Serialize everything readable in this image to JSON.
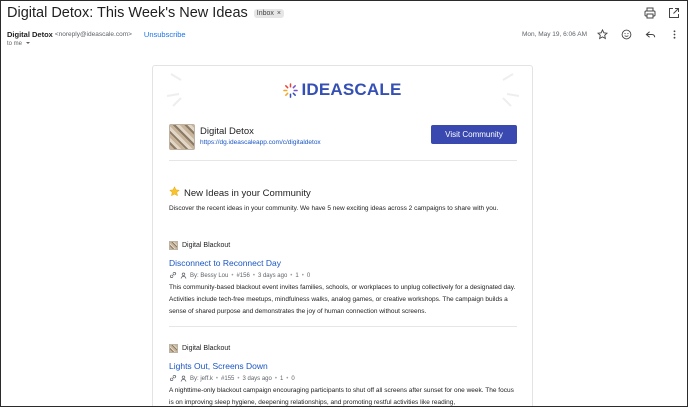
{
  "header": {
    "subject": "Digital Detox: This Week's New Ideas",
    "label_badge": "Inbox",
    "sender_name": "Digital Detox",
    "sender_email": "<noreply@ideascale.com>",
    "unsubscribe": "Unsubscribe",
    "date": "Mon, May 19, 6:06 AM",
    "to": "to me"
  },
  "email": {
    "logo_text": "IDEASCALE",
    "community_name": "Digital Detox",
    "community_url": "https://dg.ideascaleapp.com/c/digitaldetox",
    "visit_button": "Visit Community",
    "section_title": "New Ideas in your Community",
    "intro": "Discover the recent ideas in your community. We have 5 new exciting ideas across 2 campaigns to share with you.",
    "ideas": [
      {
        "campaign": "Digital Blackout",
        "title": "Disconnect to Reconnect Day",
        "author": "By: Bessy Lou",
        "number": "#156",
        "time": "3 days ago",
        "votes": "1",
        "comments": "0",
        "description": "This community-based blackout event invites families, schools, or workplaces to unplug collectively for a designated day. Activities include tech-free meetups, mindfulness walks, analog games, or creative workshops. The campaign builds a sense of shared purpose and demonstrates the joy of human connection without screens."
      },
      {
        "campaign": "Digital Blackout",
        "title": "Lights Out, Screens Down",
        "author": "By: jeff.k",
        "number": "#155",
        "time": "3 days ago",
        "votes": "1",
        "comments": "0",
        "description": "A nighttime-only blackout campaign encouraging participants to shut off all screens after sunset for one week. The focus is on improving sleep hygiene, deepening relationships, and promoting restful activities like reading,"
      }
    ]
  },
  "colors": {
    "accent": "#3949b0",
    "link": "#1a56c4"
  }
}
